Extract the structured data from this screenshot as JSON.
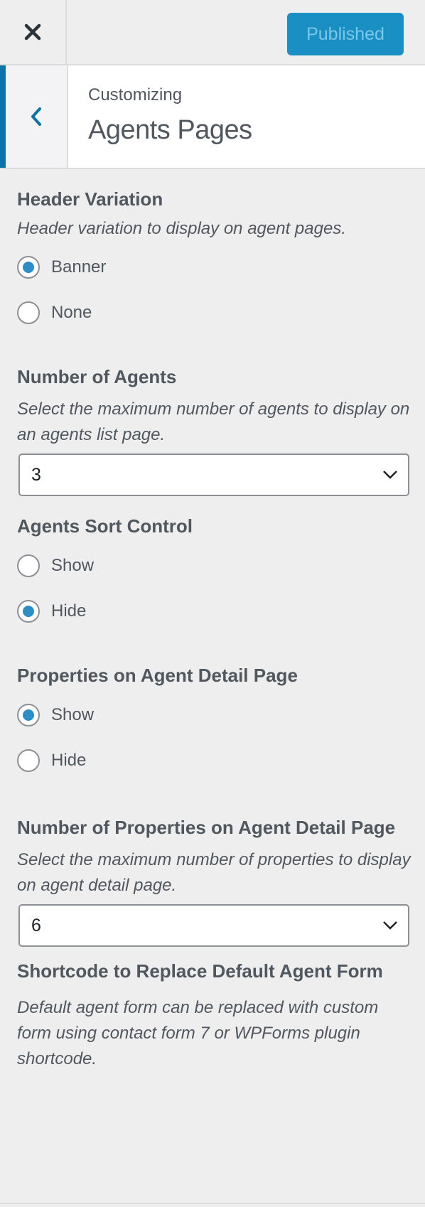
{
  "topbar": {
    "close_icon": "close-icon",
    "publish_label": "Published"
  },
  "section": {
    "back_icon": "chevron-left-icon",
    "subtitle": "Customizing",
    "title": "Agents Pages"
  },
  "controls": {
    "header_variation": {
      "title": "Header Variation",
      "description": "Header variation to display on agent pages.",
      "options": [
        {
          "label": "Banner",
          "checked": true
        },
        {
          "label": "None",
          "checked": false
        }
      ]
    },
    "number_of_agents": {
      "title": "Number of Agents",
      "description": "Select the maximum number of agents to display on an agents list page.",
      "value": "3"
    },
    "agents_sort_control": {
      "title": "Agents Sort Control",
      "options": [
        {
          "label": "Show",
          "checked": false
        },
        {
          "label": "Hide",
          "checked": true
        }
      ]
    },
    "properties_on_agent_detail": {
      "title": "Properties on Agent Detail Page",
      "options": [
        {
          "label": "Show",
          "checked": true
        },
        {
          "label": "Hide",
          "checked": false
        }
      ]
    },
    "number_of_properties": {
      "title": "Number of Properties on Agent Detail Page",
      "description": "Select the maximum number of properties to display on agent detail page.",
      "value": "6"
    },
    "shortcode_form": {
      "title": "Shortcode to Replace Default Agent Form",
      "description": "Default agent form can be replaced with custom form using contact form 7 or WPForms plugin shortcode."
    }
  },
  "colors": {
    "accent": "#2b8fc5",
    "publish_bg": "#1a8fc4",
    "back_border": "#0c73aa"
  }
}
